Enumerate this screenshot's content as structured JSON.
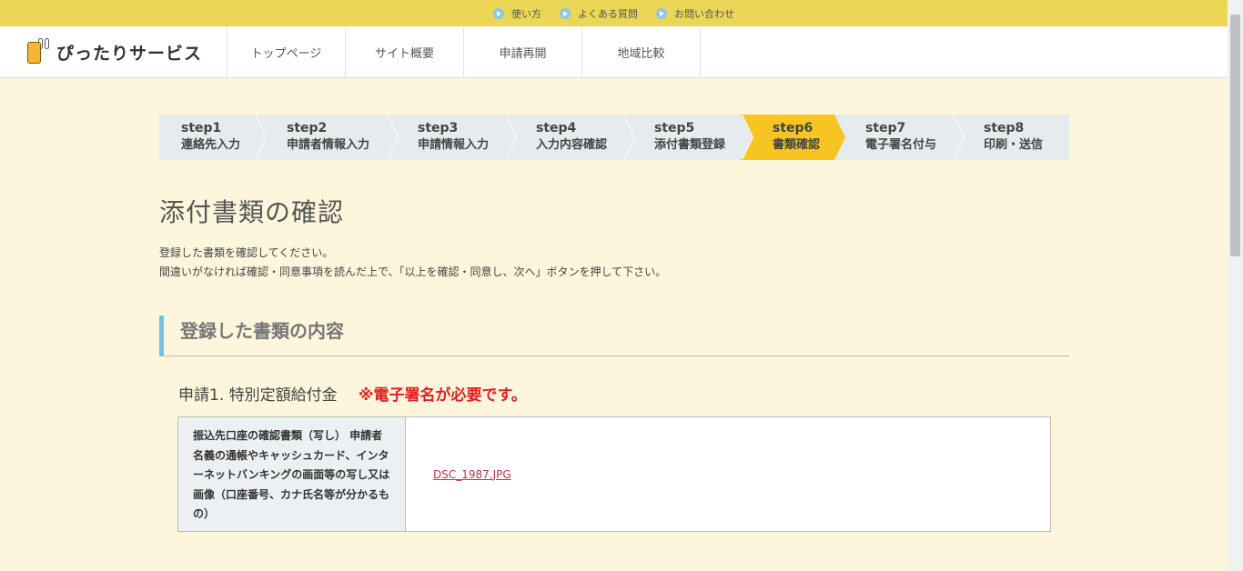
{
  "util_bar": {
    "links": [
      "使い方",
      "よくある質問",
      "お問い合わせ"
    ]
  },
  "header": {
    "logo_text": "ぴったりサービス",
    "nav": [
      "トップページ",
      "サイト概要",
      "申請再開",
      "地域比較"
    ]
  },
  "steps": [
    {
      "num": "step1",
      "label": "連絡先入力"
    },
    {
      "num": "step2",
      "label": "申請者情報入力"
    },
    {
      "num": "step3",
      "label": "申請情報入力"
    },
    {
      "num": "step4",
      "label": "入力内容確認"
    },
    {
      "num": "step5",
      "label": "添付書類登録"
    },
    {
      "num": "step6",
      "label": "書類確認",
      "active": true
    },
    {
      "num": "step7",
      "label": "電子署名付与"
    },
    {
      "num": "step8",
      "label": "印刷・送信"
    }
  ],
  "main": {
    "title": "添付書類の確認",
    "intro_line1": "登録した書類を確認してください。",
    "intro_line2": "間違いがなければ確認・同意事項を読んだ上で、「以上を確認・同意し、次へ」ボタンを押して下さい。",
    "section_title": "登録した書類の内容",
    "application_title": "申請1. 特別定額給付金",
    "warning": "※電子署名が必要です。",
    "document": {
      "label": "振込先口座の確認書類（写し） 申請者名義の通帳やキャッシュカード、インターネットバンキングの画面等の写し又は画像（口座番号、カナ氏名等が分かるもの）",
      "file": "DSC_1987.JPG"
    }
  },
  "colors": {
    "util_bar": "#ecd655",
    "active_step": "#f6c523",
    "section_accent": "#6fc3e8",
    "warning": "#e02020",
    "link": "#c0334a"
  }
}
